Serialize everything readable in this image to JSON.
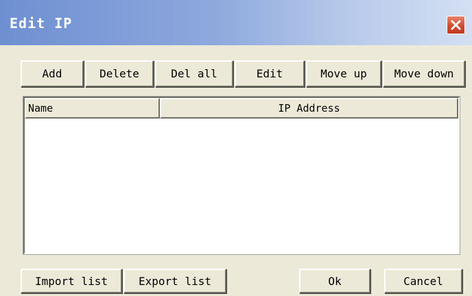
{
  "window": {
    "title": "Edit IP",
    "close_label": "close"
  },
  "toolbar": {
    "add_label": "Add",
    "delete_label": "Delete",
    "del_all_label": "Del all",
    "edit_label": "Edit",
    "move_up_label": "Move up",
    "move_down_label": "Move down"
  },
  "list": {
    "columns": [
      "Name",
      "IP Address"
    ],
    "rows": []
  },
  "footer": {
    "import_label": "Import list",
    "export_label": "Export list",
    "ok_label": "Ok",
    "cancel_label": "Cancel"
  },
  "colors": {
    "dialog_bg": "#ECE9D8",
    "title_gradient_start": "#6E8FD1",
    "title_gradient_end": "#D3DFF3",
    "close_button": "#D0492E"
  },
  "icons": {
    "close": "close-icon"
  }
}
